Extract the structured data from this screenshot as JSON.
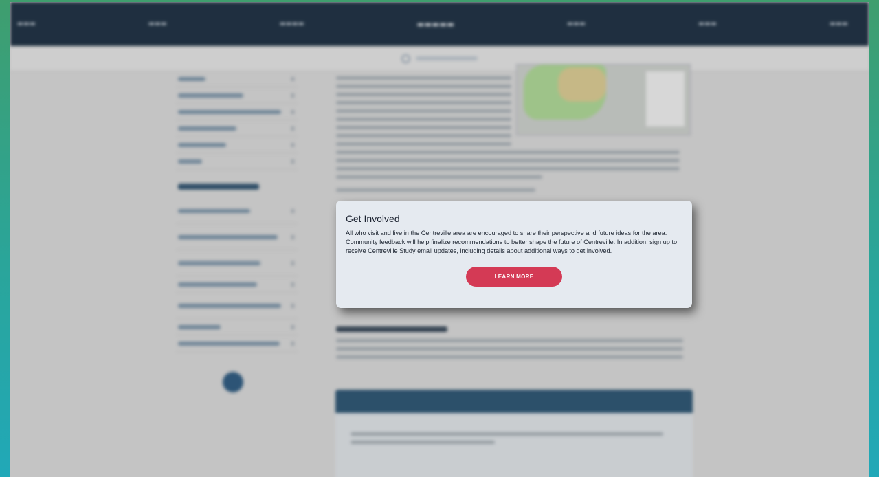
{
  "popup": {
    "title": "Get Involved",
    "body": "All who visit and live in the Centreville area are encouraged to share their perspective and future ideas for the area. Community feedback will help finalize recommendations to better shape the future of Centreville. In addition, sign up to receive Centreville Study email updates, including details about additional ways to get involved.",
    "button_label": "LEARN MORE"
  },
  "colors": {
    "nav_bg": "#0e2236",
    "button_bg": "#d43a55",
    "popup_bg": "#e5eaf0",
    "outer_frame": "#2aa59a"
  },
  "icons": {
    "search": "search-icon",
    "social": "facebook-icon"
  }
}
